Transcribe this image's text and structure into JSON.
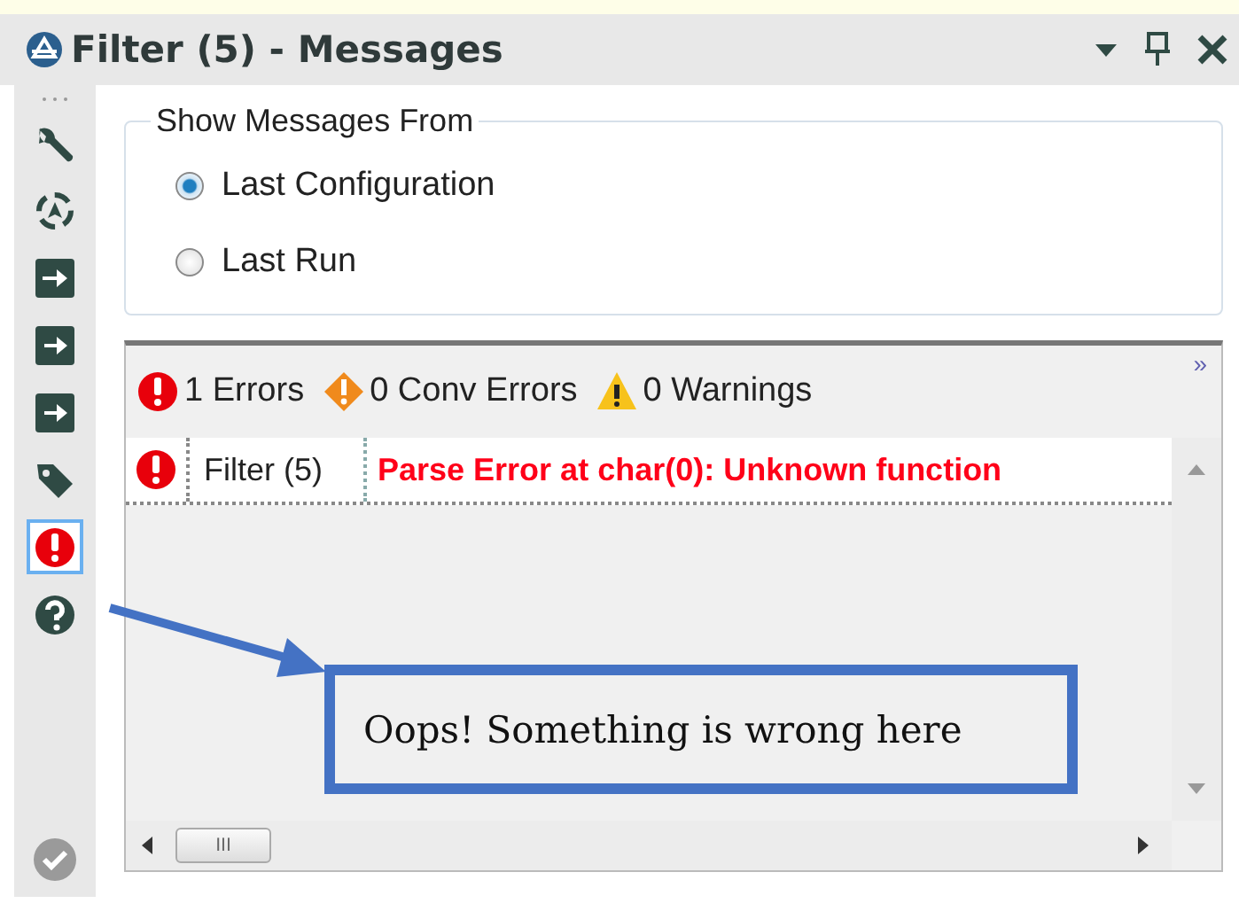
{
  "window": {
    "title": "Filter (5) - Messages"
  },
  "toolbar": [
    {
      "kind": "wrench",
      "selected": false
    },
    {
      "kind": "target",
      "selected": false
    },
    {
      "kind": "input",
      "selected": false
    },
    {
      "kind": "output",
      "selected": false
    },
    {
      "kind": "output",
      "selected": false
    },
    {
      "kind": "tag",
      "selected": false
    },
    {
      "kind": "error",
      "selected": true
    },
    {
      "kind": "help",
      "selected": false
    }
  ],
  "show_messages_from": {
    "label": "Show Messages From",
    "options": [
      {
        "label": "Last Configuration",
        "selected": true
      },
      {
        "label": "Last Run",
        "selected": false
      }
    ]
  },
  "messages": {
    "summary": [
      {
        "kind": "error",
        "label": "1 Errors"
      },
      {
        "kind": "conv",
        "label": "0 Conv Errors"
      },
      {
        "kind": "warning",
        "label": "0 Warnings"
      }
    ],
    "more": "»",
    "rows": [
      {
        "kind": "error",
        "tool": "Filter (5)",
        "message": "Parse Error at char(0): Unknown function"
      }
    ],
    "h_scroll_grip": "III"
  },
  "callout": {
    "text": "Oops! Something is wrong here"
  }
}
